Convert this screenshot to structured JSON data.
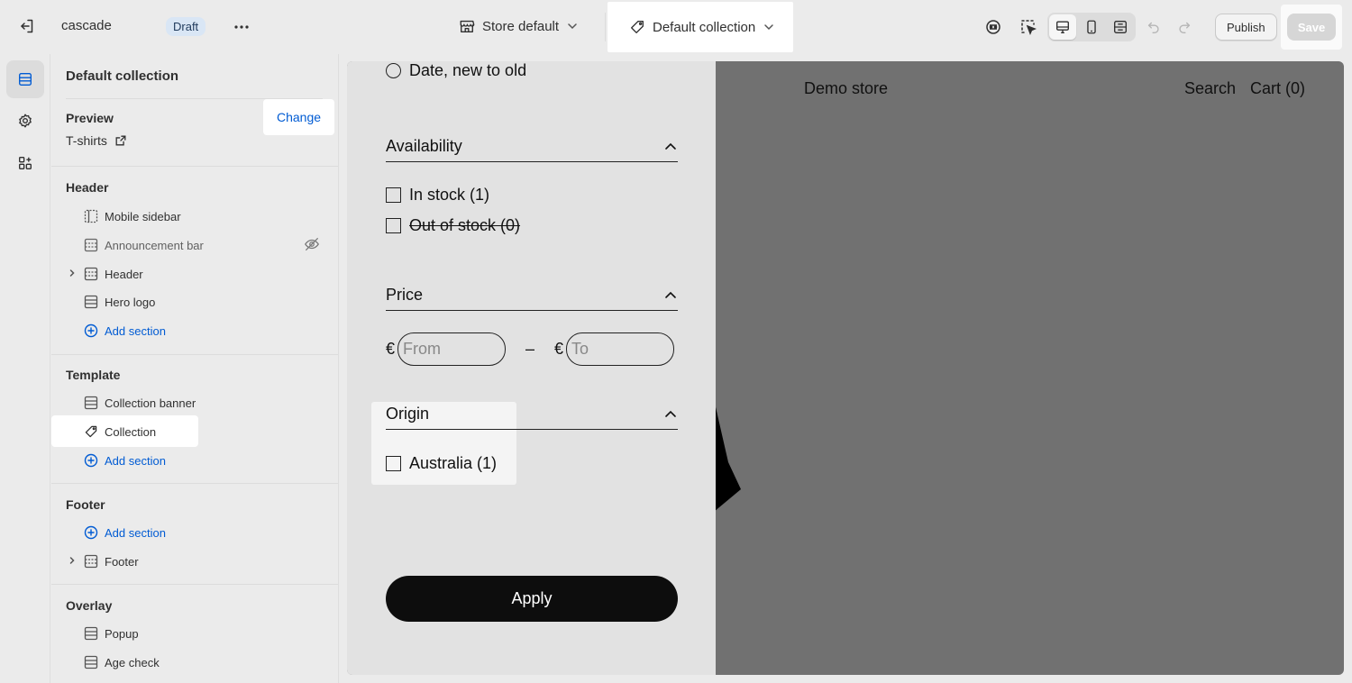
{
  "topbar": {
    "store_name": "cascade",
    "status_badge": "Draft",
    "theme_select": "Store default",
    "template_select": "Default collection",
    "publish_label": "Publish",
    "save_label": "Save"
  },
  "sidebar": {
    "title": "Default collection",
    "preview": {
      "label": "Preview",
      "value": "T-shirts",
      "change_label": "Change"
    },
    "groups": {
      "header": {
        "label": "Header",
        "items": [
          "Mobile sidebar",
          "Announcement bar",
          "Header",
          "Hero logo"
        ],
        "add_label": "Add section"
      },
      "template": {
        "label": "Template",
        "items": [
          "Collection banner",
          "Collection"
        ],
        "add_label": "Add section"
      },
      "footer": {
        "label": "Footer",
        "add_label": "Add section",
        "items": [
          "Footer"
        ]
      },
      "overlay": {
        "label": "Overlay",
        "items": [
          "Popup",
          "Age check"
        ]
      }
    }
  },
  "preview": {
    "store_title": "Demo store",
    "nav": {
      "search": "Search",
      "cart": "Cart (0)"
    },
    "filters": {
      "sort_option": "Date, new to old",
      "availability": {
        "title": "Availability",
        "options": [
          "In stock (1)",
          "Out of stock (0)"
        ]
      },
      "price": {
        "title": "Price",
        "currency": "€",
        "separator": "–",
        "from_placeholder": "From",
        "to_placeholder": "To"
      },
      "origin": {
        "title": "Origin",
        "options": [
          "Australia (1)"
        ]
      },
      "apply_label": "Apply"
    }
  },
  "colors": {
    "accent_link": "#005bd3",
    "badge_bg": "#d9e6f5",
    "preview_bg": "#717171",
    "filter_panel_bg": "#e2e2e2",
    "apply_button": "#0d0d0d"
  }
}
